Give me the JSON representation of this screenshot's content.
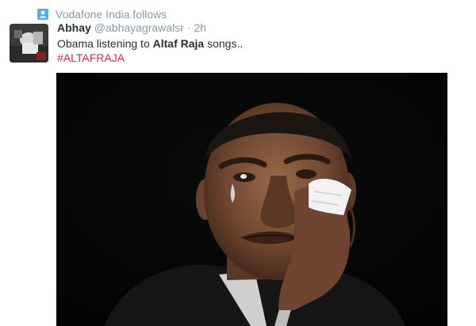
{
  "colors": {
    "accent": "#55acee",
    "hashtag": "#e0245e",
    "muted": "#8899a6",
    "text": "#292f33"
  },
  "social_context": {
    "icon": "follow-icon",
    "text": "Vodafone India follows"
  },
  "tweet": {
    "avatar": "avatar",
    "fullname": "Abhay",
    "username": "@abhayagrawalsr",
    "separator": "·",
    "time": "2h",
    "text_before": "Obama listening to ",
    "text_bold": "Altaf Raja",
    "text_after": " songs..",
    "hashtag": "#ALTAFRAJA"
  },
  "media": {
    "type": "photo"
  }
}
